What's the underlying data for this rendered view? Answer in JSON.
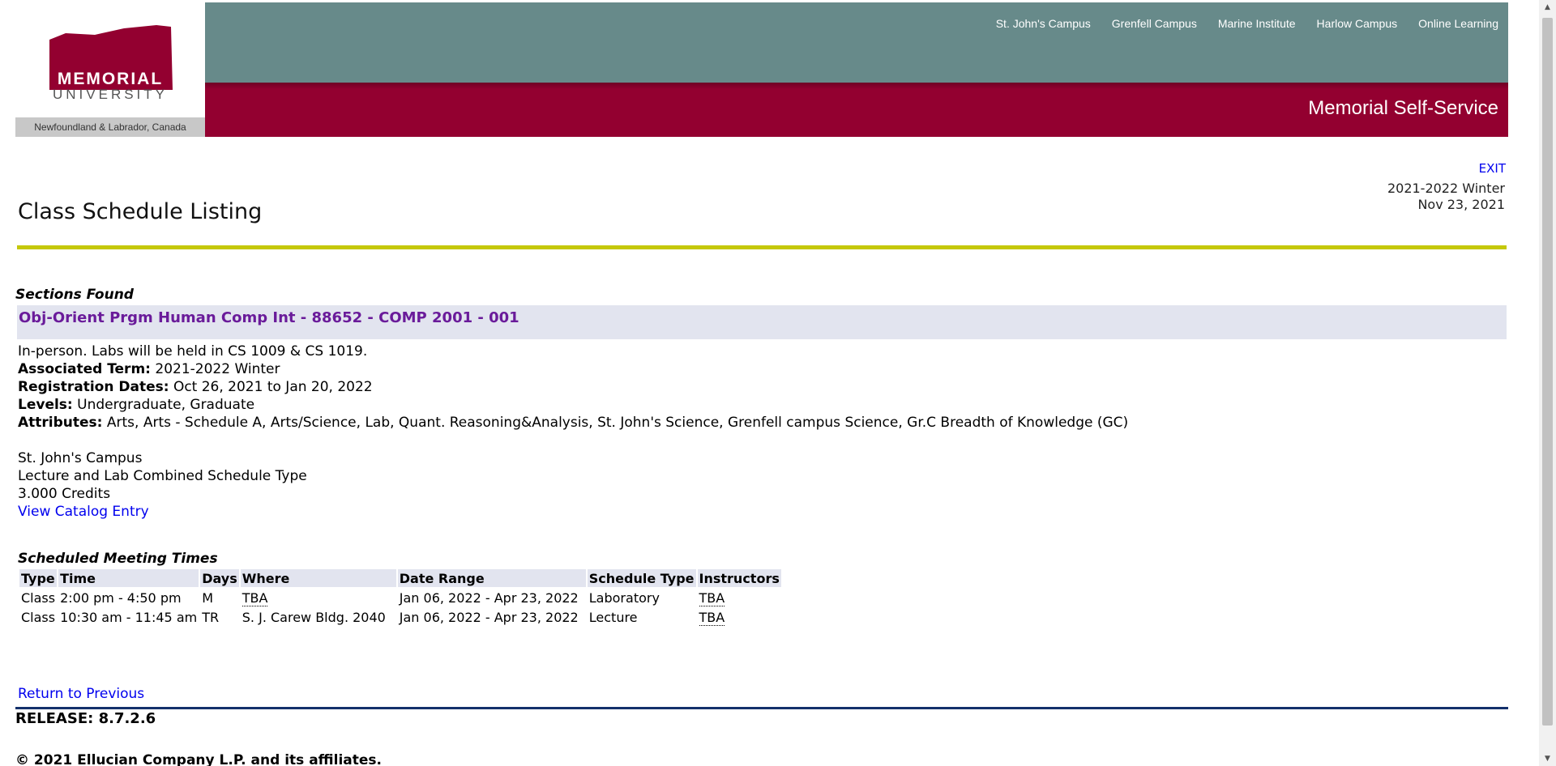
{
  "header": {
    "logo_name": "MEMORIAL",
    "logo_sub_name": "UNIVERSITY",
    "logo_location": "Newfoundland & Labrador, Canada",
    "campus_links": [
      "St. John's Campus",
      "Grenfell Campus",
      "Marine Institute",
      "Harlow Campus",
      "Online Learning"
    ],
    "site_title": "Memorial Self-Service"
  },
  "colors": {
    "teal_bar": "#678a8a",
    "crimson_bar": "#930030",
    "yellow_rule": "#c5c80a",
    "navy_rule": "#13306b",
    "section_header_bg": "#e2e4ef",
    "link": "#0000ee",
    "section_link": "#6a1b9a"
  },
  "top": {
    "exit_label": "EXIT",
    "term": "2021-2022 Winter",
    "date": "Nov 23, 2021",
    "page_title": "Class Schedule Listing"
  },
  "content": {
    "sections_found_label": "Sections Found",
    "section_title": "Obj-Orient Prgm Human Comp Int - 88652 - COMP 2001 - 001",
    "note": "In-person. Labs will be held in CS 1009 & CS 1019.",
    "associated_term_label": "Associated Term:",
    "associated_term_value": "2021-2022 Winter",
    "registration_dates_label": "Registration Dates:",
    "registration_dates_value": "Oct 26, 2021 to Jan 20, 2022",
    "levels_label": "Levels:",
    "levels_value": "Undergraduate, Graduate",
    "attributes_label": "Attributes:",
    "attributes_value": "Arts, Arts - Schedule A, Arts/Science, Lab, Quant. Reasoning&Analysis, St. John's Science, Grenfell campus Science, Gr.C Breadth of Knowledge (GC)",
    "campus": "St. John's Campus",
    "schedule_type": "Lecture and Lab Combined Schedule Type",
    "credits": "3.000 Credits",
    "catalog_link": "View Catalog Entry"
  },
  "meeting_times": {
    "caption": "Scheduled Meeting Times",
    "headers": [
      "Type",
      "Time",
      "Days",
      "Where",
      "Date Range",
      "Schedule Type",
      "Instructors"
    ],
    "rows": [
      [
        "Class",
        "2:00 pm - 4:50 pm",
        "M",
        "TBA",
        "Jan 06, 2022 - Apr 23, 2022",
        "Laboratory",
        "TBA"
      ],
      [
        "Class",
        "10:30 am - 11:45 am",
        "TR",
        "S. J. Carew Bldg. 2040",
        "Jan 06, 2022 - Apr 23, 2022",
        "Lecture",
        "TBA"
      ]
    ]
  },
  "footer": {
    "return_link": "Return to Previous",
    "release": "RELEASE: 8.7.2.6",
    "copyright": "© 2021 Ellucian Company L.P. and its affiliates."
  }
}
